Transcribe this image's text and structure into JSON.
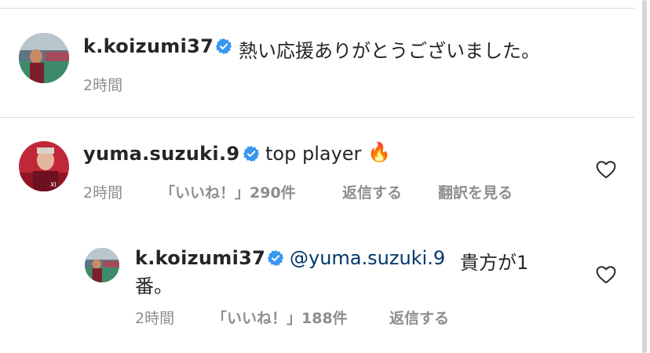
{
  "comments": [
    {
      "username": "k.koizumi37",
      "text": "熱い応援ありがとうございました。",
      "time": "2時間"
    },
    {
      "username": "yuma.suzuki.9",
      "text": "top player",
      "emoji": "🔥",
      "time": "2時間",
      "likes": "「いいね！」290件",
      "reply_label": "返信する",
      "translate_label": "翻訳を見る"
    },
    {
      "username": "k.koizumi37",
      "mention": "@yuma.suzuki.9",
      "text_line1": "貴方が1",
      "text_line2": "番。",
      "time": "2時間",
      "likes": "「いいね！」188件",
      "reply_label": "返信する"
    }
  ],
  "colors": {
    "verified": "#3897f0",
    "mention": "#00376b",
    "meta": "#8e8e8e",
    "divider": "#dbdbdb"
  },
  "icons": [
    "verified-badge-icon",
    "heart-icon"
  ]
}
